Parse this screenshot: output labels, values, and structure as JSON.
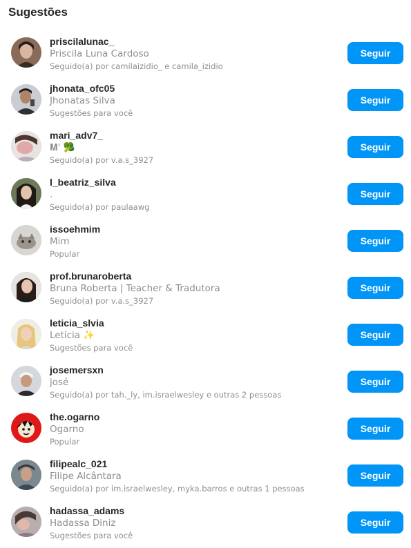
{
  "header": {
    "title": "Sugestões"
  },
  "follow_label": "Seguir",
  "colors": {
    "accent": "#0095f6",
    "secondary_text": "#8e8e8e"
  },
  "suggestions": [
    {
      "username": "priscilalunac_",
      "full_name": "Priscila Luna Cardoso",
      "subtitle": "Seguido(a) por camilaizidio_ e camila_izidio"
    },
    {
      "username": "jhonata_ofc05",
      "full_name": "Jhonatas Silva",
      "subtitle": "Sugestões para você"
    },
    {
      "username": "mari_adv7_",
      "full_name": "𝐌' 🥦",
      "subtitle": "Seguido(a) por v.a.s_3927"
    },
    {
      "username": "l_beatriz_silva",
      "full_name": ".",
      "subtitle": "Seguido(a) por paulaawg"
    },
    {
      "username": "issoehmim",
      "full_name": "Mim",
      "subtitle": "Popular"
    },
    {
      "username": "prof.brunaroberta",
      "full_name": "Bruna Roberta | Teacher & Tradutora",
      "subtitle": "Seguido(a) por v.a.s_3927"
    },
    {
      "username": "leticia_slvia",
      "full_name": "Letícia ✨",
      "subtitle": "Sugestões para você"
    },
    {
      "username": "josemersxn",
      "full_name": "josé",
      "subtitle": "Seguido(a) por tah._ly, im.israelwesley e outras 2 pessoas"
    },
    {
      "username": "the.ogarno",
      "full_name": "Ogarno",
      "subtitle": "Popular"
    },
    {
      "username": "filipealc_021",
      "full_name": "Filipe Alcântara",
      "subtitle": "Seguido(a) por im.israelwesley, myka.barros e outras 1 pessoas"
    },
    {
      "username": "hadassa_adams",
      "full_name": "Hadassa Diniz",
      "subtitle": "Sugestões para você"
    }
  ]
}
